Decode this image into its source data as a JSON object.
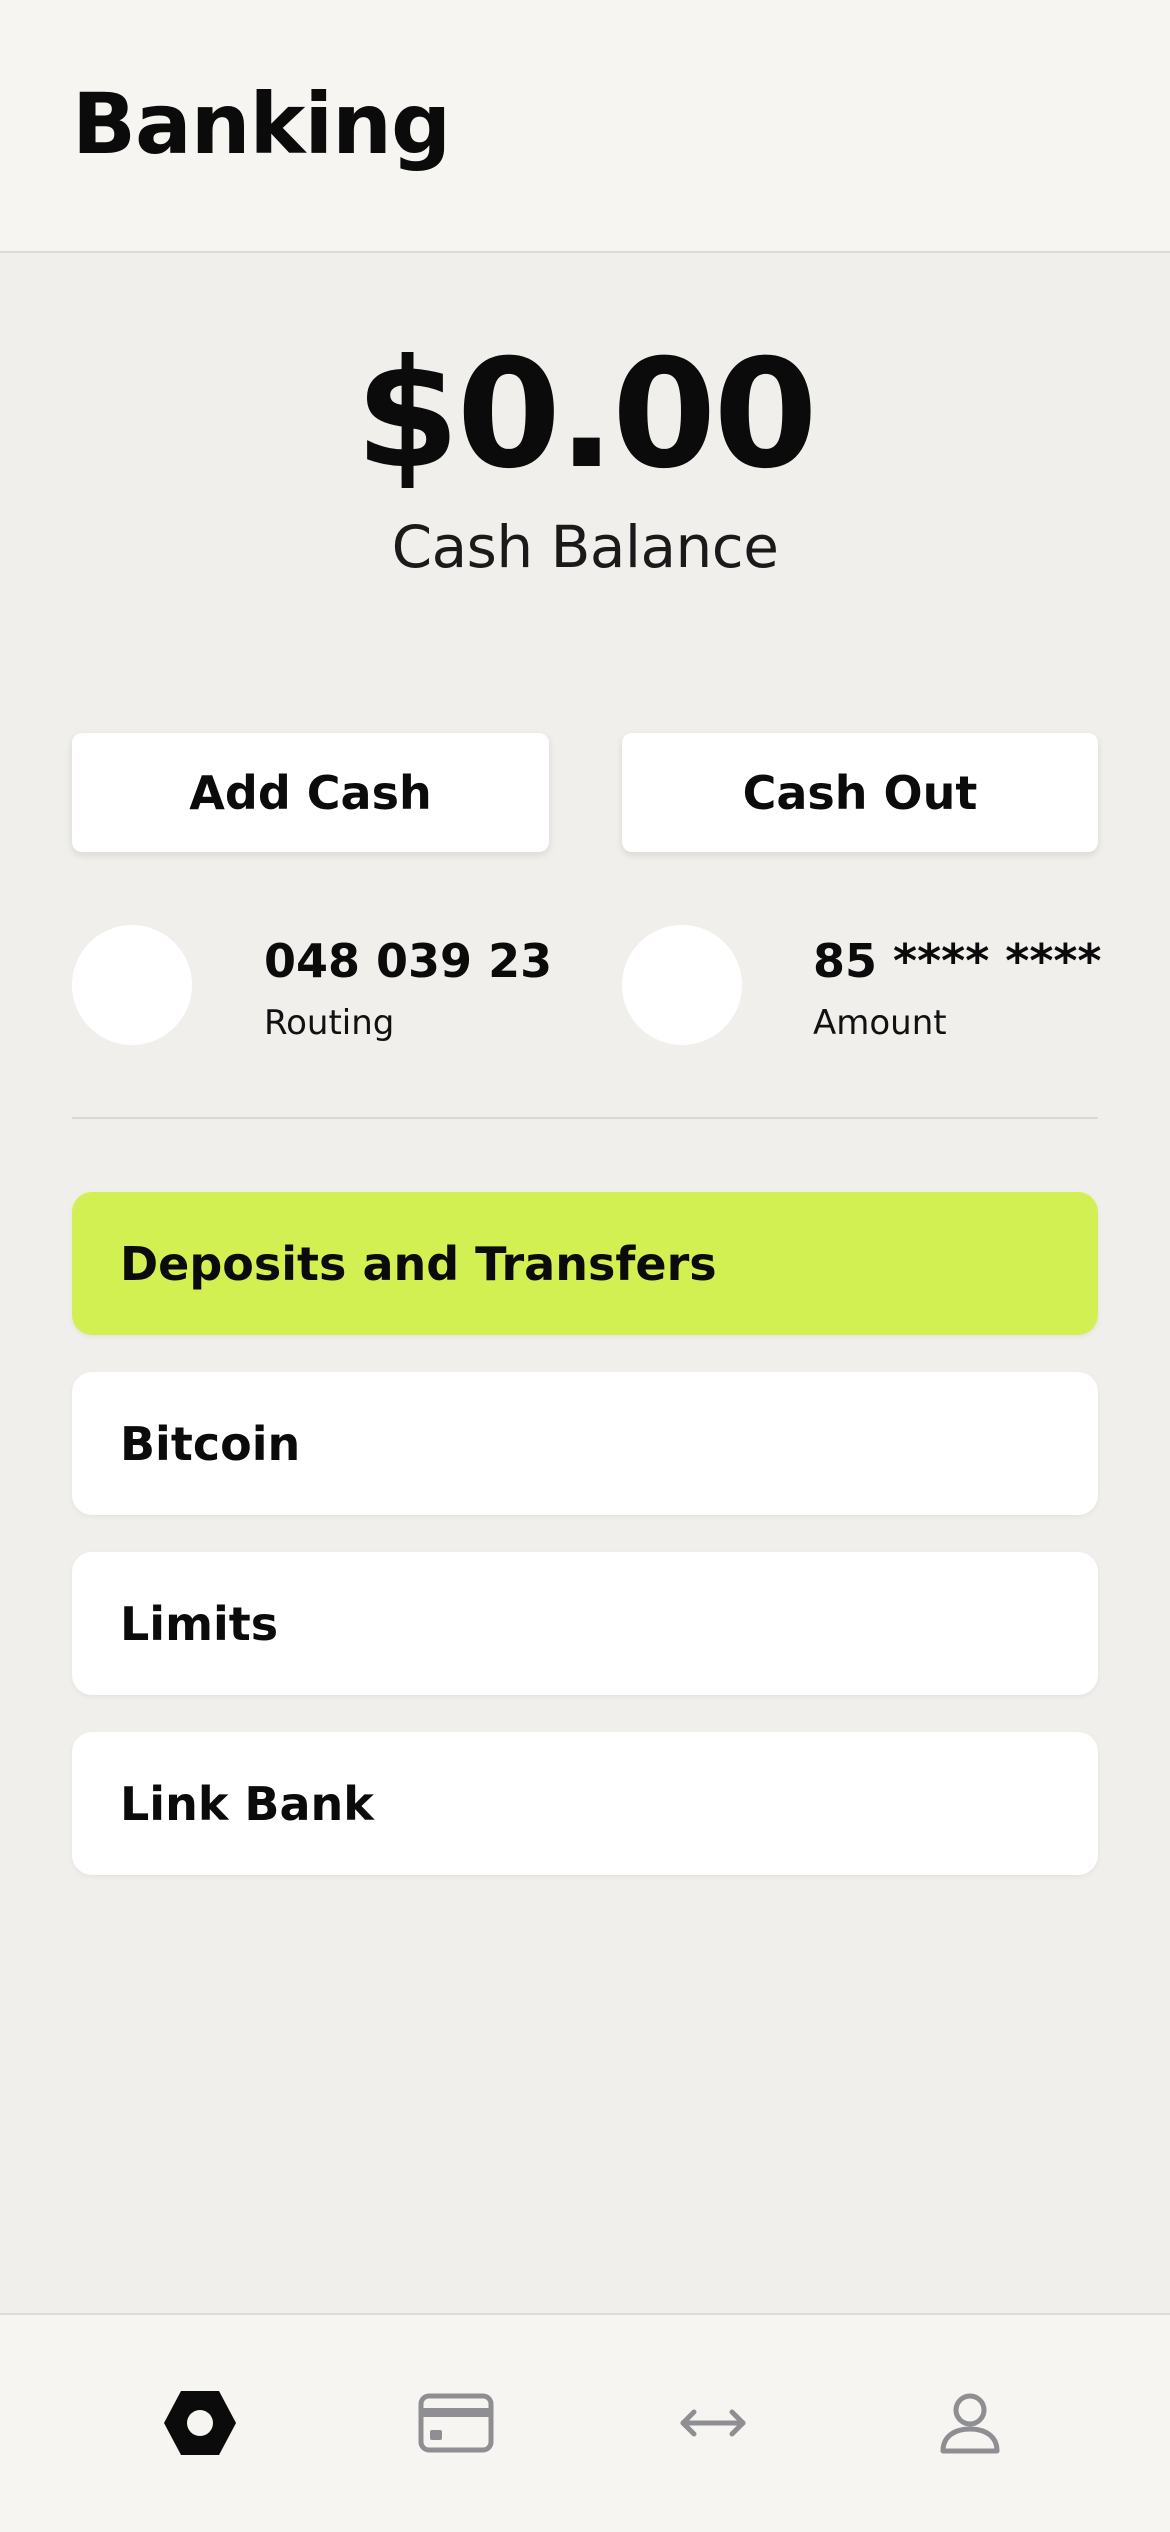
{
  "header": {
    "title": "Banking"
  },
  "balance": {
    "amount": "$0.00",
    "label": "Cash Balance"
  },
  "actions": {
    "add_cash": "Add Cash",
    "cash_out": "Cash Out"
  },
  "accounts": [
    {
      "value": "048 039 23",
      "label": "Routing"
    },
    {
      "value": "85 **** ****",
      "label": "Amount"
    }
  ],
  "menu": [
    {
      "label": "Deposits and Transfers",
      "active": true
    },
    {
      "label": "Bitcoin",
      "active": false
    },
    {
      "label": "Limits",
      "active": false
    },
    {
      "label": "Link Bank",
      "active": false
    }
  ],
  "tabbar": {
    "tabs": [
      {
        "icon": "home-hexagon-icon",
        "active": true
      },
      {
        "icon": "card-icon",
        "active": false
      },
      {
        "icon": "transfer-arrows-icon",
        "active": false
      },
      {
        "icon": "profile-icon",
        "active": false
      }
    ]
  },
  "colors": {
    "accent": "#d3f053",
    "background": "#f0efeb",
    "surface": "#ffffff",
    "inactive_icon": "#8e8e93"
  }
}
